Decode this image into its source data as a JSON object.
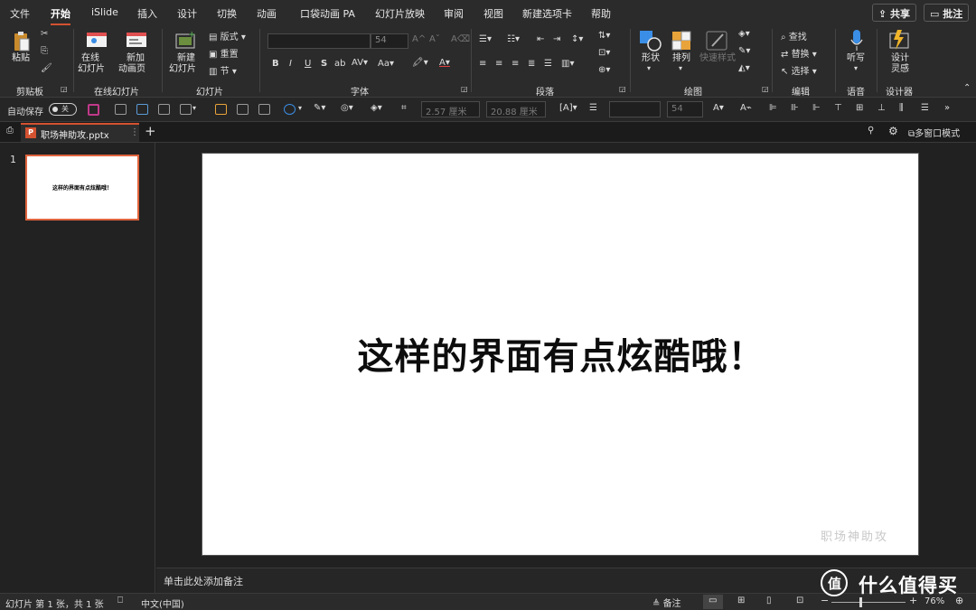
{
  "menu": {
    "items": [
      "文件",
      "开始",
      "iSlide",
      "插入",
      "设计",
      "切换",
      "动画",
      "口袋动画 PA",
      "幻灯片放映",
      "审阅",
      "视图",
      "新建选项卡",
      "帮助"
    ],
    "active": "开始",
    "share_label": "共享",
    "comment_label": "批注"
  },
  "ribbon": {
    "clipboard": {
      "paste_label": "粘贴",
      "group_label": "剪贴板"
    },
    "online": {
      "online_slide_label_1": "在线",
      "online_slide_label_2": "幻灯片",
      "new_anim_label_1": "新加",
      "new_anim_label_2": "动画页",
      "group_label": "在线幻灯片"
    },
    "slides": {
      "new_slide_label_1": "新建",
      "new_slide_label_2": "幻灯片",
      "layout_label": "版式",
      "reset_label": "重置",
      "section_label": "节",
      "group_label": "幻灯片"
    },
    "font": {
      "size_value": "54",
      "bold": "B",
      "italic": "I",
      "underline": "U",
      "strike": "S",
      "group_label": "字体"
    },
    "paragraph": {
      "group_label": "段落"
    },
    "drawing": {
      "shapes_label": "形状",
      "arrange_label": "排列",
      "quick_styles_label": "快速样式",
      "group_label": "绘图"
    },
    "editing": {
      "find_label": "查找",
      "replace_label": "替换",
      "select_label": "选择",
      "group_label": "编辑"
    },
    "voice": {
      "dictate_label": "听写",
      "group_label": "语音"
    },
    "designer": {
      "ideas_label_1": "设计",
      "ideas_label_2": "灵感",
      "group_label": "设计器"
    }
  },
  "qat": {
    "autosave_label": "自动保存",
    "autosave_state": "关",
    "width_value": "2.57 厘米",
    "height_value": "20.88 厘米",
    "font_size_value": "54",
    "more_label": "»"
  },
  "tabstrip": {
    "file_tab_label": "职场神助攻.pptx",
    "multi_window_label": "多窗口模式",
    "add_tab": "+"
  },
  "thumbnails": [
    {
      "number": "1",
      "text": "这样的界面有点炫酷哦！"
    }
  ],
  "slide": {
    "title": "这样的界面有点炫酷哦！",
    "watermark": "职场神助攻"
  },
  "notes": {
    "placeholder": "单击此处添加备注"
  },
  "status": {
    "slide_info": "幻灯片 第 1 张，共 1 张",
    "language": "中文(中国)",
    "notes_label": "备注",
    "zoom": "76%"
  },
  "brand": {
    "watermark_text": "什么值得买",
    "logo_char": "值"
  },
  "colors": {
    "accent": "#d35230",
    "ribbon_bg": "#2b2b2b",
    "slide_bg": "#ffffff",
    "blue_icon": "#3a8ee6"
  }
}
